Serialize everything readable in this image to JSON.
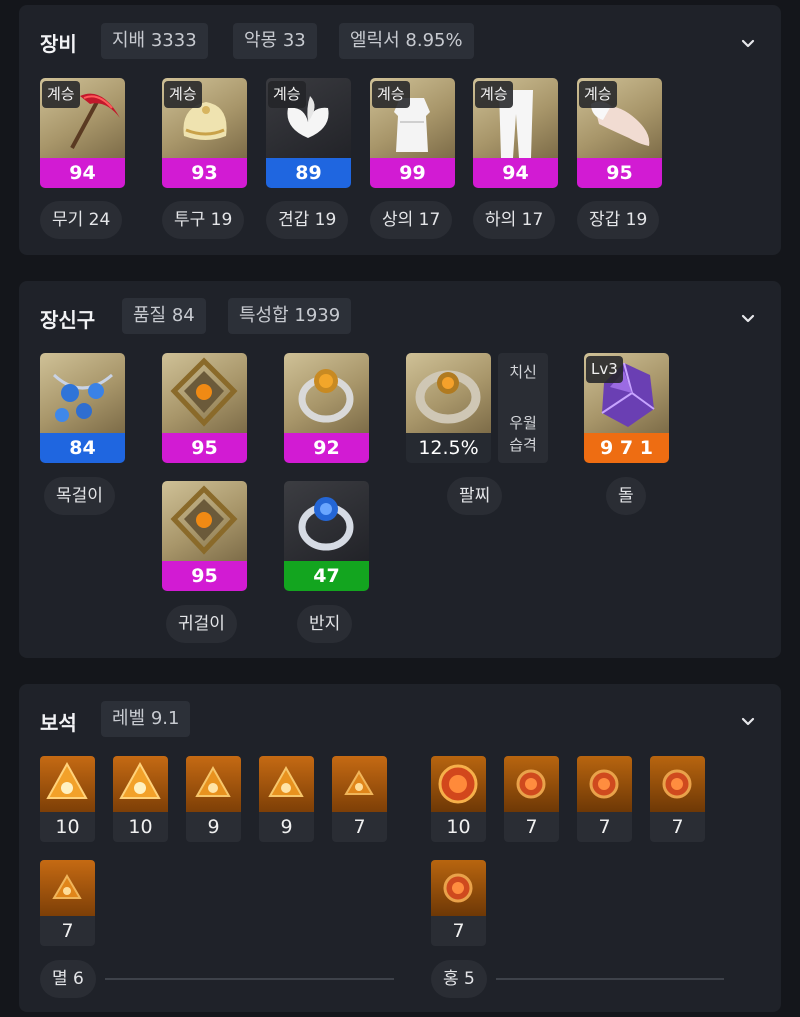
{
  "equipment": {
    "title": "장비",
    "chips": [
      "지배 3333",
      "악몽 33",
      "엘릭서 8.95%"
    ],
    "items": [
      {
        "badge": "계승",
        "value": "94",
        "label": "무기 24",
        "icon": "pickaxe-weapon-icon",
        "quality_color": "#d21bd3"
      },
      {
        "badge": "계승",
        "value": "93",
        "label": "투구 19",
        "icon": "helmet-icon",
        "quality_color": "#d21bd3"
      },
      {
        "badge": "계승",
        "value": "89",
        "label": "견갑 19",
        "icon": "shoulder-icon",
        "quality_color": "#1f66e0"
      },
      {
        "badge": "계승",
        "value": "99",
        "label": "상의 17",
        "icon": "dress-top-icon",
        "quality_color": "#d21bd3"
      },
      {
        "badge": "계승",
        "value": "94",
        "label": "하의 17",
        "icon": "pants-icon",
        "quality_color": "#d21bd3"
      },
      {
        "badge": "계승",
        "value": "95",
        "label": "장갑 19",
        "icon": "gloves-icon",
        "quality_color": "#d21bd3"
      }
    ]
  },
  "accessories": {
    "title": "장신구",
    "chips": [
      "품질 84",
      "특성합 1939"
    ],
    "necklace": {
      "value": "84",
      "label": "목걸이",
      "icon": "necklace-icon"
    },
    "earrings": [
      {
        "value": "95",
        "icon": "earring-icon"
      },
      {
        "value": "95",
        "icon": "earring-icon"
      }
    ],
    "earring_label": "귀걸이",
    "rings": [
      {
        "value": "92",
        "icon": "ring-icon"
      },
      {
        "value": "47",
        "icon": "ring-icon"
      }
    ],
    "ring_label": "반지",
    "bracelet": {
      "value": "12.5%",
      "label": "팔찌",
      "stats": [
        "치신",
        "우월",
        "습격"
      ],
      "icon": "bracelet-icon"
    },
    "stone": {
      "badge": "Lv3",
      "value": "9 7 1",
      "label": "돌",
      "icon": "stone-crystal-icon"
    }
  },
  "gems": {
    "title": "보석",
    "chips": [
      "레벨 9.1"
    ],
    "left_group": {
      "label": "멸 6",
      "values": [
        "10",
        "10",
        "9",
        "9",
        "7",
        "7"
      ],
      "icon": "annihilation-gem-icon"
    },
    "right_group": {
      "label": "홍 5",
      "values": [
        "10",
        "7",
        "7",
        "7",
        "7"
      ],
      "icon": "crimson-gem-icon"
    }
  },
  "icons": {
    "expand": "chevron-down-icon"
  },
  "colors": {
    "pink": "#d21bd3",
    "blue": "#1f66e0",
    "green": "#13a51f",
    "orange": "#ee6d12"
  }
}
